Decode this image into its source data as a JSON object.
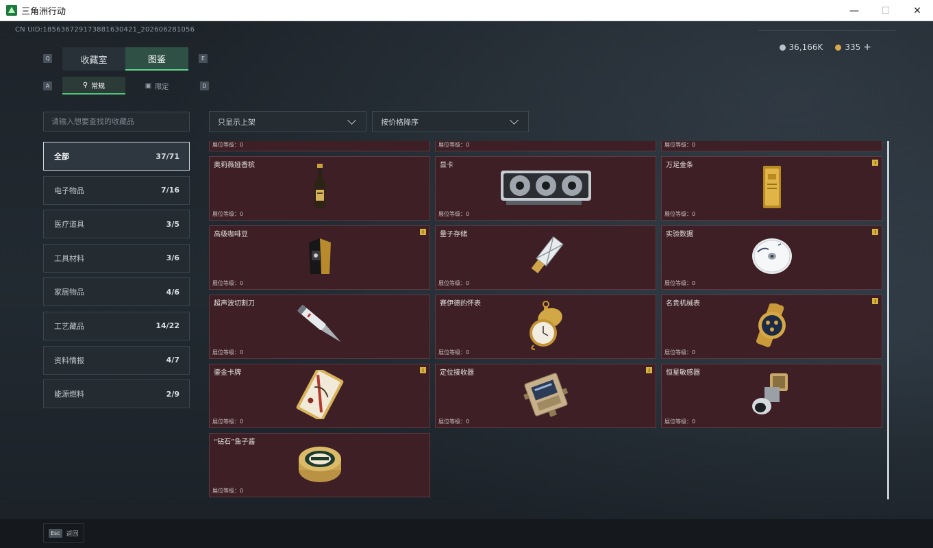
{
  "window": {
    "title": "三角洲行动",
    "controls": [
      "minimize",
      "maximize",
      "close"
    ]
  },
  "header": {
    "uid": "CN UID:1856367291738816304​21_202606281056",
    "currency": {
      "coins": "36,166K",
      "gold": "335",
      "add": "+"
    }
  },
  "tabs": {
    "main": [
      {
        "label": "收藏室",
        "active": false
      },
      {
        "label": "图鉴",
        "active": true
      }
    ],
    "main_keys": {
      "left": "Q",
      "right": "E"
    },
    "sub": [
      {
        "label": "常规",
        "icon": "bottle-icon",
        "active": true
      },
      {
        "label": "限定",
        "icon": "image-icon",
        "active": false
      }
    ],
    "sub_keys": {
      "left": "A",
      "right": "D"
    }
  },
  "search": {
    "placeholder": "请输入想要查找的收藏品",
    "value": ""
  },
  "filters": {
    "show": {
      "selected": "只显示上架"
    },
    "sort": {
      "selected": "按价格降序"
    }
  },
  "categories": [
    {
      "label": "全部",
      "count": "37/71",
      "active": true
    },
    {
      "label": "电子物品",
      "count": "7/16"
    },
    {
      "label": "医疗道具",
      "count": "3/5"
    },
    {
      "label": "工具材料",
      "count": "3/6"
    },
    {
      "label": "家居物品",
      "count": "4/6"
    },
    {
      "label": "工艺藏品",
      "count": "14/22"
    },
    {
      "label": "资料情报",
      "count": "4/7"
    },
    {
      "label": "能源燃料",
      "count": "2/9"
    }
  ],
  "items": [
    {
      "name": "",
      "level": "展位等级：0",
      "partial": true
    },
    {
      "name": "",
      "level": "展位等级：0",
      "partial": true
    },
    {
      "name": "",
      "level": "展位等级：0",
      "partial": true
    },
    {
      "name": "奥莉薇娅香槟",
      "level": "展位等级：0",
      "flag": false,
      "art": "champagne"
    },
    {
      "name": "显卡",
      "level": "展位等级：0",
      "flag": false,
      "art": "gpu"
    },
    {
      "name": "万足金条",
      "level": "展位等级：0",
      "flag": true,
      "art": "goldbar"
    },
    {
      "name": "高级咖啡豆",
      "level": "展位等级：0",
      "flag": true,
      "art": "coffee"
    },
    {
      "name": "量子存储",
      "level": "展位等级：0",
      "flag": false,
      "art": "usb"
    },
    {
      "name": "实验数据",
      "level": "展位等级：0",
      "flag": true,
      "art": "disc"
    },
    {
      "name": "超声波切割刀",
      "level": "展位等级：0",
      "flag": false,
      "art": "knife"
    },
    {
      "name": "赛伊德的怀表",
      "level": "展位等级：0",
      "flag": false,
      "art": "pocketwatch"
    },
    {
      "name": "名贵机械表",
      "level": "展位等级：0",
      "flag": true,
      "art": "wristwatch"
    },
    {
      "name": "鎏金卡牌",
      "level": "展位等级：0",
      "flag": true,
      "art": "card"
    },
    {
      "name": "定位接收器",
      "level": "展位等级：0",
      "flag": true,
      "art": "receiver"
    },
    {
      "name": "恒星敏感器",
      "level": "展位等级：0",
      "flag": false,
      "art": "sensor"
    },
    {
      "name": "“钻石”鱼子酱",
      "level": "展位等级：0",
      "flag": false,
      "art": "caviar"
    }
  ],
  "footer": {
    "esc_key": "Esc",
    "back_label": "返回"
  }
}
